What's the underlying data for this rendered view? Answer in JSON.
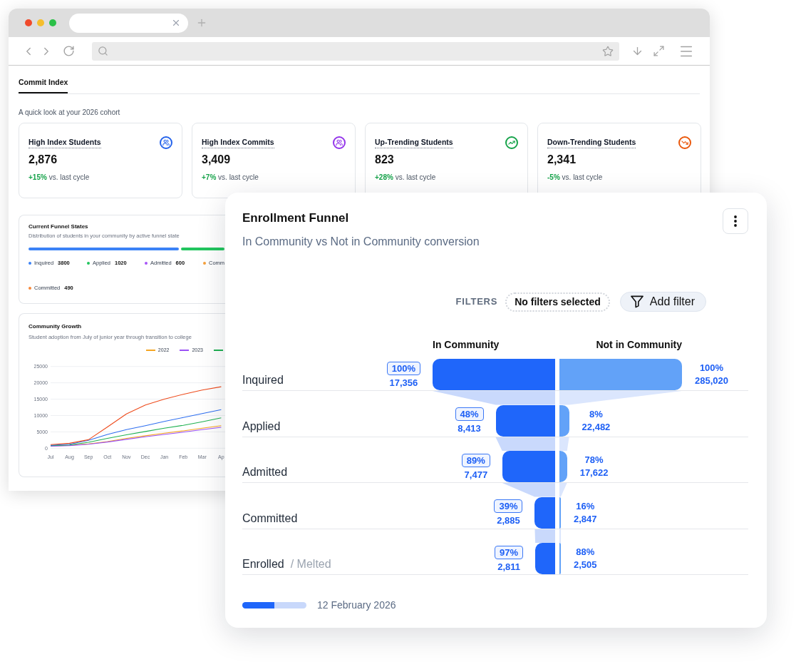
{
  "page_tabs": [
    {
      "label": "Commit Index",
      "selected": true
    }
  ],
  "intro": "A quick look at your 2026 cohort",
  "kpi_cards": [
    {
      "title": "High Index Students",
      "kind": "users",
      "color": "#2563eb",
      "value": "2,876",
      "change": "+15%",
      "comparison": "vs. last cycle"
    },
    {
      "title": "High Index Commits",
      "kind": "users",
      "color": "#9333ea",
      "value": "3,409",
      "change": "+7%",
      "comparison": "vs. last cycle"
    },
    {
      "title": "Up-Trending Students",
      "kind": "trend-up",
      "color": "#16a34a",
      "value": "823",
      "change": "+28%",
      "comparison": "vs. last cycle"
    },
    {
      "title": "Down-Trending Students",
      "kind": "trend-down",
      "color": "#ea580c",
      "value": "2,341",
      "change": "-5%",
      "comparison": "vs. last cycle"
    }
  ],
  "funnel_states": {
    "title": "Current Funnel States",
    "subtitle": "Distribution of students in your community by active funnel state",
    "segments": [
      {
        "color": "#3b82f6",
        "level": 0.765
      },
      {
        "color": "#22c55e",
        "level": 0.22
      }
    ],
    "legend": [
      {
        "label": "Inquired",
        "value": "3800",
        "color": "#3b82f6"
      },
      {
        "label": "Applied",
        "value": "1020",
        "color": "#22c55e"
      },
      {
        "label": "Admitted",
        "value": "600",
        "color": "#a855f7"
      },
      {
        "label": "Comm",
        "color": "#f5a03c"
      },
      {
        "label": "Committed",
        "value": "490",
        "color": "#f7883a"
      }
    ]
  },
  "community_growth": {
    "title": "Community Growth",
    "subtitle": "Student adoption from July of junior year through transition to college",
    "legend": [
      {
        "label": "2022",
        "color": "#f5a623"
      },
      {
        "label": "2023",
        "color": "#9b51f5"
      },
      {
        "color": "#1fb151"
      }
    ],
    "chart_data": {
      "type": "line",
      "categories": [
        "Jul",
        "Aug",
        "Sep",
        "Oct",
        "Nov",
        "Dec",
        "Jan",
        "Feb",
        "Mar",
        "Ap"
      ],
      "ylim": [
        0,
        25000
      ],
      "yticks": [
        0,
        5000,
        10000,
        15000,
        20000,
        25000
      ],
      "grid": true,
      "series": [
        {
          "color": "#f5a623",
          "values": [
            700,
            900,
            1300,
            2000,
            3000,
            3800,
            4600,
            5300,
            6100,
            6900
          ]
        },
        {
          "color": "#9b51f5",
          "values": [
            600,
            800,
            1200,
            1900,
            2700,
            3500,
            4200,
            4900,
            5700,
            6400
          ]
        },
        {
          "color": "#1fb151",
          "values": [
            800,
            1000,
            1800,
            3000,
            4100,
            5100,
            6100,
            7000,
            8100,
            9300
          ]
        },
        {
          "color": "#2f6ff0",
          "values": [
            900,
            1200,
            2400,
            4200,
            5700,
            6900,
            8200,
            9400,
            10600,
            11800
          ]
        },
        {
          "color": "#ee4b1c",
          "values": [
            1100,
            1500,
            2600,
            6500,
            10500,
            13200,
            15000,
            16500,
            17800,
            18800
          ]
        }
      ]
    }
  },
  "enrollment_funnel": {
    "title": "Enrollment Funnel",
    "subtitle": "In Community vs Not in Community conversion",
    "filters_label": "FILTERS",
    "filter_status": "No filters selected",
    "add_filter": "Add filter",
    "columns": [
      "In Community",
      "Not in Community"
    ],
    "stages": [
      {
        "label": "Inquired",
        "in_community": {
          "percent": "100%",
          "count": "17,356",
          "level": 1
        },
        "not_in_community": {
          "percent": "100%",
          "count": "285,020",
          "level": 1
        }
      },
      {
        "label": "Applied",
        "in_community": {
          "percent": "48%",
          "count": "8,413",
          "level": 0.485
        },
        "not_in_community": {
          "percent": "8%",
          "count": "22,482",
          "level": 0.079
        }
      },
      {
        "label": "Admitted",
        "in_community": {
          "percent": "89%",
          "count": "7,477",
          "level": 0.431
        },
        "not_in_community": {
          "percent": "78%",
          "count": "17,622",
          "level": 0.062
        }
      },
      {
        "label": "Committed",
        "in_community": {
          "percent": "39%",
          "count": "2,885",
          "level": 0.166
        },
        "not_in_community": {
          "percent": "16%",
          "count": "2,847",
          "level": 0.01
        }
      },
      {
        "label": "Enrolled",
        "note": "/ Melted",
        "in_community": {
          "percent": "97%",
          "count": "2,811",
          "level": 0.162
        },
        "not_in_community": {
          "percent": "88%",
          "count": "2,505",
          "level": 0.009
        }
      }
    ],
    "footer": {
      "level": 0.5,
      "date": "12 February 2026"
    }
  }
}
